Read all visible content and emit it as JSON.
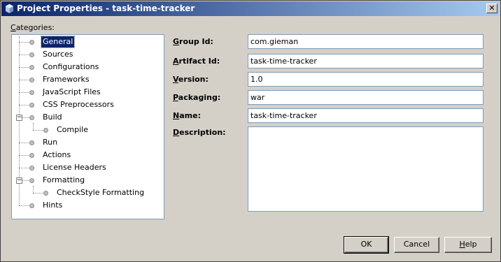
{
  "window": {
    "title": "Project Properties - task-time-tracker",
    "close_glyph": "✕"
  },
  "categories": {
    "label_prefix": "C",
    "label_rest": "ategories:",
    "items": [
      {
        "label": "General",
        "selected": true
      },
      {
        "label": "Sources"
      },
      {
        "label": "Configurations"
      },
      {
        "label": "Frameworks"
      },
      {
        "label": "JavaScript Files"
      },
      {
        "label": "CSS Preprocessors"
      },
      {
        "label": "Build",
        "expanded": true
      },
      {
        "label": "Compile",
        "child": true
      },
      {
        "label": "Run"
      },
      {
        "label": "Actions"
      },
      {
        "label": "License Headers"
      },
      {
        "label": "Formatting",
        "expanded": true
      },
      {
        "label": "CheckStyle Formatting",
        "child": true
      },
      {
        "label": "Hints"
      }
    ],
    "expander_glyph": "−"
  },
  "form": {
    "group_id": {
      "mnemonic": "G",
      "rest": "roup Id:",
      "value": "com.gieman"
    },
    "artifact_id": {
      "mnemonic": "A",
      "rest": "rtifact Id:",
      "value": "task-time-tracker"
    },
    "version": {
      "mnemonic": "V",
      "rest": "ersion:",
      "value": "1.0"
    },
    "packaging": {
      "mnemonic": "P",
      "rest": "ackaging:",
      "value": "war"
    },
    "name": {
      "mnemonic": "N",
      "rest": "ame:",
      "value": "task-time-tracker"
    },
    "description": {
      "mnemonic": "D",
      "rest": "escription:",
      "value": ""
    }
  },
  "buttons": {
    "ok": "OK",
    "cancel": "Cancel",
    "help_mnemonic": "H",
    "help_rest": "elp"
  }
}
